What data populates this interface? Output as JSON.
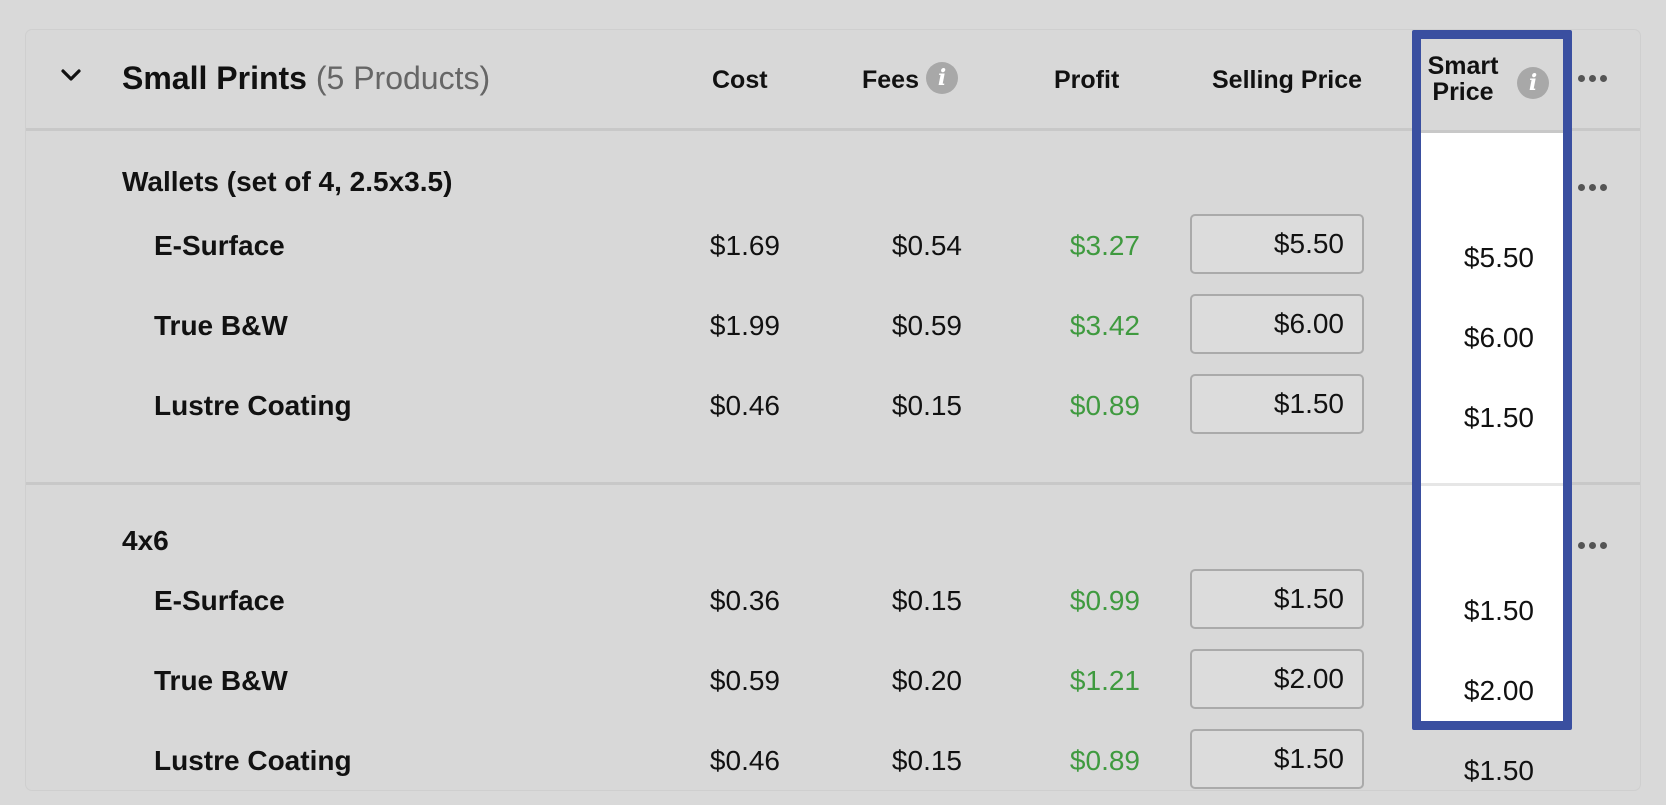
{
  "section": {
    "title": "Small Prints",
    "count": "(5 Products)"
  },
  "columns": {
    "cost": "Cost",
    "fees": "Fees",
    "profit": "Profit",
    "selling_price": "Selling Price",
    "smart_line1": "Smart",
    "smart_line2": "Price"
  },
  "icons": {
    "info": "i",
    "collapse": "chevron-down-icon",
    "more": "more-horizontal-icon"
  },
  "colors": {
    "profit": "#3f9a3f",
    "highlight_border": "#3a4fa0"
  },
  "groups": [
    {
      "name": "Wallets (set of 4, 2.5x3.5)",
      "rows": [
        {
          "name": "E-Surface",
          "cost": "$1.69",
          "fees": "$0.54",
          "profit": "$3.27",
          "selling": "$5.50",
          "smart": "$5.50"
        },
        {
          "name": "True B&W",
          "cost": "$1.99",
          "fees": "$0.59",
          "profit": "$3.42",
          "selling": "$6.00",
          "smart": "$6.00"
        },
        {
          "name": "Lustre Coating",
          "cost": "$0.46",
          "fees": "$0.15",
          "profit": "$0.89",
          "selling": "$1.50",
          "smart": "$1.50"
        }
      ]
    },
    {
      "name": "4x6",
      "rows": [
        {
          "name": "E-Surface",
          "cost": "$0.36",
          "fees": "$0.15",
          "profit": "$0.99",
          "selling": "$1.50",
          "smart": "$1.50"
        },
        {
          "name": "True B&W",
          "cost": "$0.59",
          "fees": "$0.20",
          "profit": "$1.21",
          "selling": "$2.00",
          "smart": "$2.00"
        },
        {
          "name": "Lustre Coating",
          "cost": "$0.46",
          "fees": "$0.15",
          "profit": "$0.89",
          "selling": "$1.50",
          "smart": "$1.50"
        }
      ]
    }
  ]
}
